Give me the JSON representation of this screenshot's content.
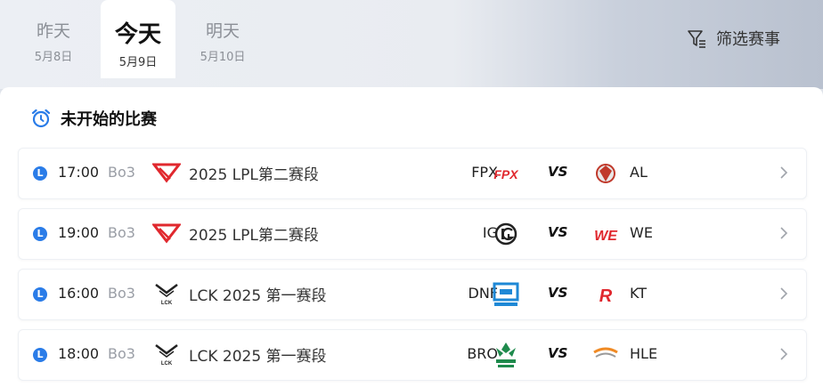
{
  "date_tabs": [
    {
      "day": "昨天",
      "date": "5月8日"
    },
    {
      "day": "今天",
      "date": "5月9日"
    },
    {
      "day": "明天",
      "date": "5月10日"
    }
  ],
  "filter": {
    "label": "筛选赛事",
    "icon": "filter-icon"
  },
  "section": {
    "title": "未开始的比赛",
    "icon": "alarm-clock-icon"
  },
  "matches": [
    {
      "badge": "L",
      "time": "17:00",
      "format": "Bo3",
      "league": "2025 LPL第二赛段",
      "league_icon": "lpl-logo-icon",
      "team_a": "FPX",
      "team_a_icon": "fpx-logo-icon",
      "vs": "VS",
      "team_b": "AL",
      "team_b_icon": "al-logo-icon"
    },
    {
      "badge": "L",
      "time": "19:00",
      "format": "Bo3",
      "league": "2025 LPL第二赛段",
      "league_icon": "lpl-logo-icon",
      "team_a": "IG",
      "team_a_icon": "ig-logo-icon",
      "vs": "VS",
      "team_b": "WE",
      "team_b_icon": "we-logo-icon"
    },
    {
      "badge": "L",
      "time": "16:00",
      "format": "Bo3",
      "league": "LCK 2025 第一赛段",
      "league_icon": "lck-logo-icon",
      "team_a": "DNF",
      "team_a_icon": "dnf-logo-icon",
      "vs": "VS",
      "team_b": "KT",
      "team_b_icon": "kt-logo-icon"
    },
    {
      "badge": "L",
      "time": "18:00",
      "format": "Bo3",
      "league": "LCK 2025 第一赛段",
      "league_icon": "lck-logo-icon",
      "team_a": "BRO",
      "team_a_icon": "bro-logo-icon",
      "vs": "VS",
      "team_b": "HLE",
      "team_b_icon": "hle-logo-icon"
    }
  ],
  "colors": {
    "accent": "#2a7ce8",
    "lpl_red": "#e0282e",
    "active_tab_bg": "#ffffff"
  }
}
